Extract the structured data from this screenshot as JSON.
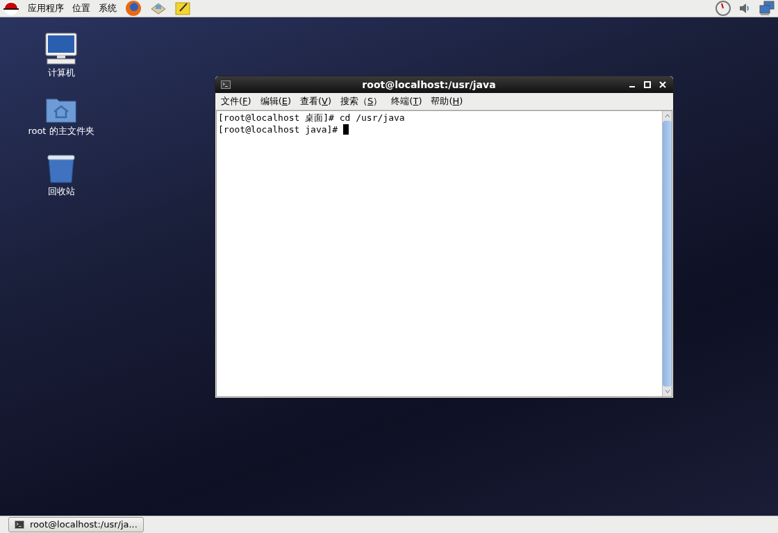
{
  "top_panel": {
    "menus": [
      "应用程序",
      "位置",
      "系统"
    ]
  },
  "desktop_icons": [
    {
      "kind": "computer",
      "label": "计算机"
    },
    {
      "kind": "home",
      "label": "root 的主文件夹"
    },
    {
      "kind": "trash",
      "label": "回收站"
    }
  ],
  "terminal_window": {
    "title": "root@localhost:/usr/java",
    "menu": [
      {
        "before": "文件(",
        "mnemonic": "F",
        "after": ")"
      },
      {
        "before": "编辑(",
        "mnemonic": "E",
        "after": ")"
      },
      {
        "before": "查看(",
        "mnemonic": "V",
        "after": ")"
      },
      {
        "before": "搜索（",
        "mnemonic": "S",
        "after": "）"
      },
      {
        "before": "终端(",
        "mnemonic": "T",
        "after": ")"
      },
      {
        "before": "帮助(",
        "mnemonic": "H",
        "after": ")"
      }
    ],
    "lines": [
      {
        "text": "[root@localhost 桌面]# cd /usr/java",
        "cursor": false
      },
      {
        "text": "[root@localhost java]# ",
        "cursor": true
      }
    ]
  },
  "taskbar": {
    "tasks": [
      {
        "label": "root@localhost:/usr/ja...",
        "selected": false
      }
    ]
  }
}
